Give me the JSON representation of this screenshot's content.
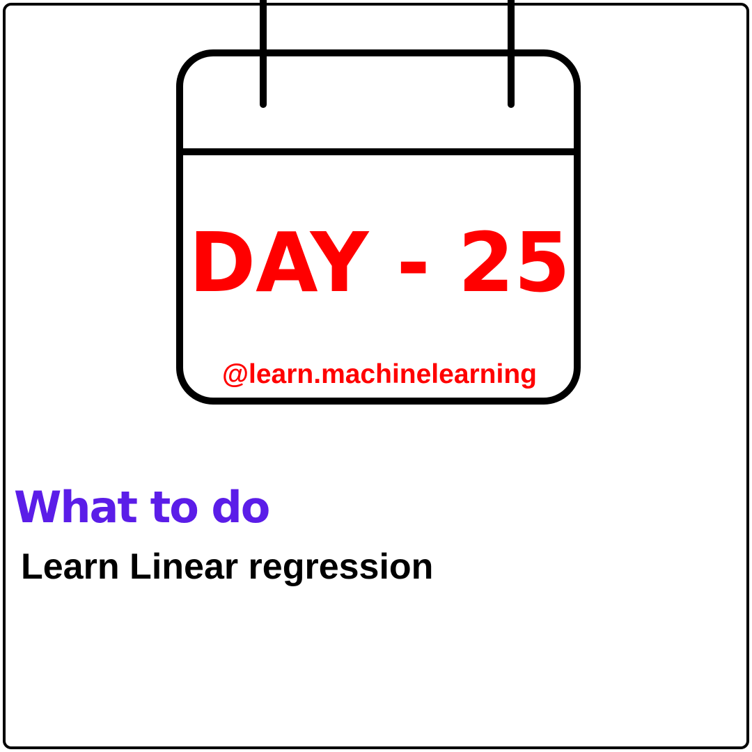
{
  "calendar": {
    "day_label": "DAY - 25",
    "handle": "@learn.machinelearning"
  },
  "section": {
    "heading": "What to do",
    "task": "Learn Linear regression"
  },
  "colors": {
    "day_color": "#ff0000",
    "handle_color": "#ff0000",
    "heading_color": "#5b1de8",
    "text_color": "#000000",
    "stroke_color": "#000000"
  },
  "icons": {
    "calendar": "calendar-icon"
  }
}
